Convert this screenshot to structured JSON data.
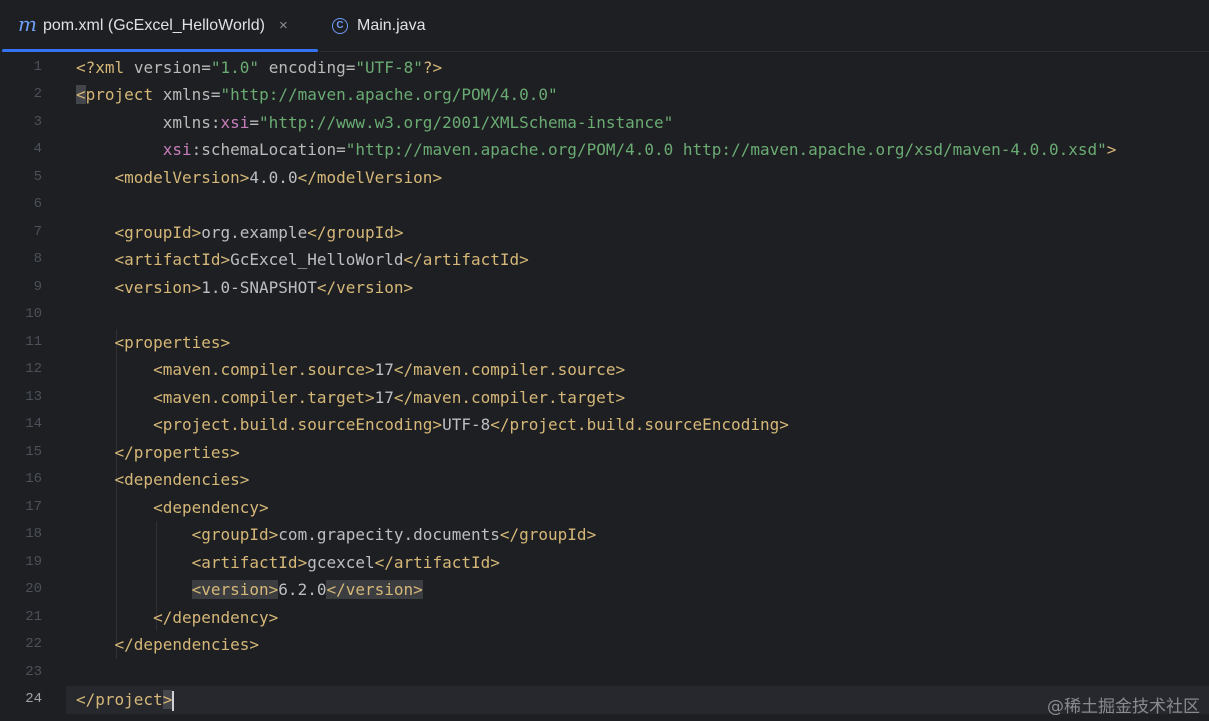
{
  "tabs": [
    {
      "label": "pom.xml (GcExcel_HelloWorld)",
      "icon": "maven-m-icon",
      "active": true,
      "close": "×"
    },
    {
      "label": "Main.java",
      "icon": "java-class-icon",
      "active": false
    }
  ],
  "editor": {
    "current_line": 24,
    "line_numbers": [
      "1",
      "2",
      "3",
      "4",
      "5",
      "6",
      "7",
      "8",
      "9",
      "10",
      "11",
      "12",
      "13",
      "14",
      "15",
      "16",
      "17",
      "18",
      "19",
      "20",
      "21",
      "22",
      "23",
      "24"
    ],
    "lines": [
      "<?xml version=\"1.0\" encoding=\"UTF-8\"?>",
      "<project xmlns=\"http://maven.apache.org/POM/4.0.0\"",
      "         xmlns:xsi=\"http://www.w3.org/2001/XMLSchema-instance\"",
      "         xsi:schemaLocation=\"http://maven.apache.org/POM/4.0.0 http://maven.apache.org/xsd/maven-4.0.0.xsd\">",
      "    <modelVersion>4.0.0</modelVersion>",
      "",
      "    <groupId>org.example</groupId>",
      "    <artifactId>GcExcel_HelloWorld</artifactId>",
      "    <version>1.0-SNAPSHOT</version>",
      "",
      "    <properties>",
      "        <maven.compiler.source>17</maven.compiler.source>",
      "        <maven.compiler.target>17</maven.compiler.target>",
      "        <project.build.sourceEncoding>UTF-8</project.build.sourceEncoding>",
      "    </properties>",
      "    <dependencies>",
      "        <dependency>",
      "            <groupId>com.grapecity.documents</groupId>",
      "            <artifactId>gcexcel</artifactId>",
      "            <version>6.2.0</version>",
      "        </dependency>",
      "    </dependencies>",
      "",
      "</project>"
    ]
  },
  "watermark": "@稀土掘金技术社区",
  "colors": {
    "background": "#1e1f22",
    "tag": "#d5b778",
    "string": "#6aab73",
    "namespace": "#c77dbb",
    "text": "#bcbec4",
    "line_number": "#4b5059",
    "accent": "#3574f0"
  }
}
